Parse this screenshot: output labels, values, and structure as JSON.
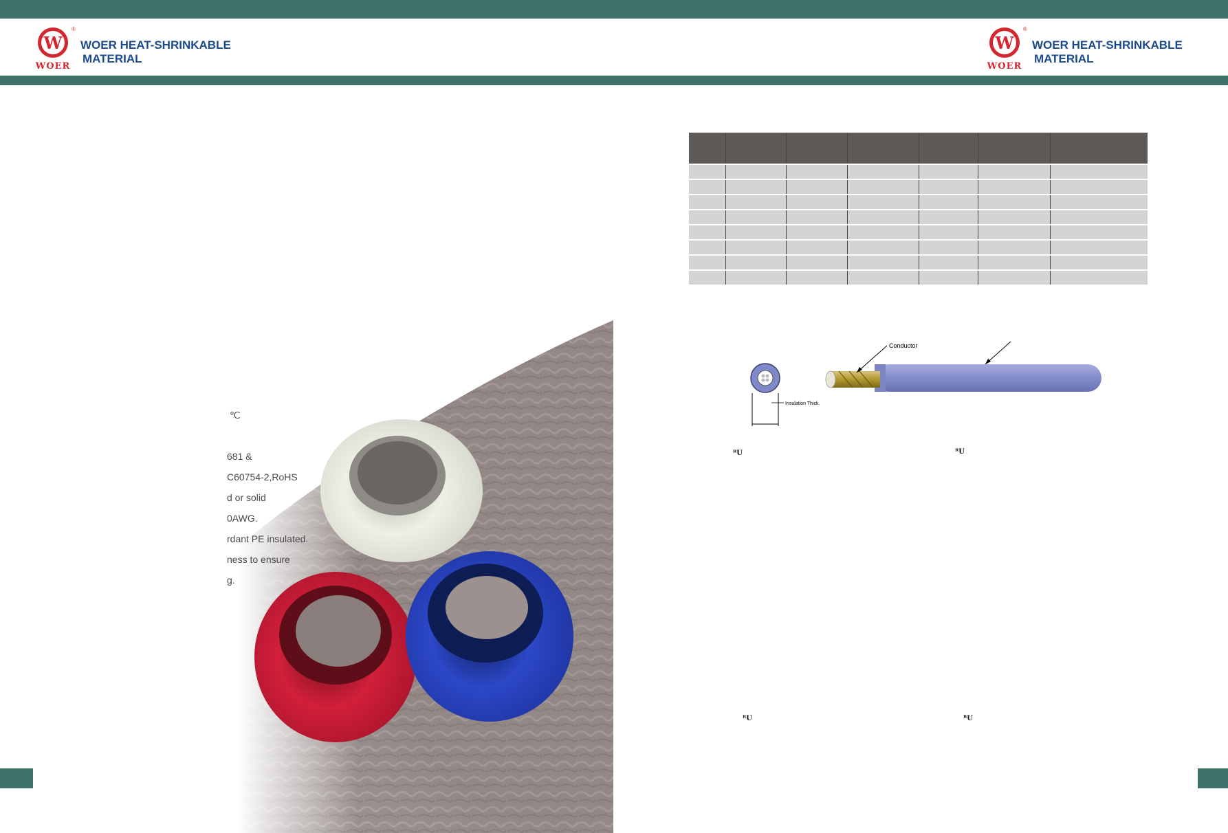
{
  "header": {
    "brand_line1": "WOER HEAT-SHRINKABLE",
    "brand_line2": "MATERIAL",
    "logo_letter": "W",
    "logo_word": "WOER",
    "registered": "®",
    "colors": {
      "band": "#3e7268",
      "brand_text": "#1b4a8c",
      "logo_red": "#d3262e"
    }
  },
  "features": {
    "lines": [
      " ℃",
      "681 &",
      "C60754-2,RoHS",
      "d or solid",
      "0AWG.",
      "rdant PE insulated.",
      "ness to ensure",
      "g."
    ]
  },
  "spec_table": {
    "header_bg": "#5e5a58",
    "row_bg": "#d4d4d4",
    "columns": 7,
    "rows": 8
  },
  "diagram": {
    "conductor_label": "Conductor",
    "insulation_label": "Insulation Thick.",
    "insulation_color": "#8890cc"
  },
  "cert_marks": [
    "ᴿU",
    "ᴿU",
    "ᴿU",
    "ᴿU"
  ]
}
